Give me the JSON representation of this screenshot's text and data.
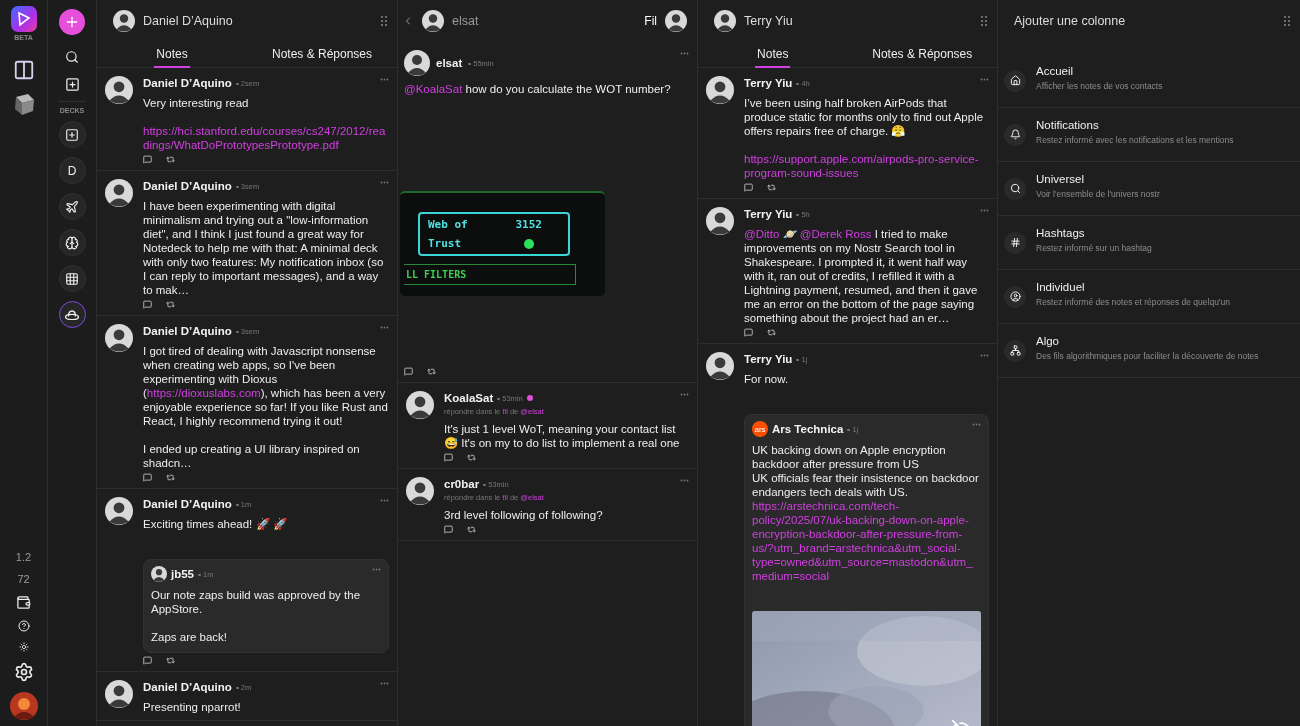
{
  "app_rail": {
    "badge": "BETA",
    "version": "1.2",
    "count": "72"
  },
  "deck_bar": {
    "label": "DECKS",
    "decks": [
      {
        "kind": "add",
        "selected": false
      },
      {
        "kind": "letter",
        "text": "D",
        "selected": false
      },
      {
        "kind": "plane",
        "selected": false
      },
      {
        "kind": "brain",
        "selected": false
      },
      {
        "kind": "grid",
        "selected": false
      },
      {
        "kind": "hat",
        "selected": true
      }
    ]
  },
  "columns": [
    {
      "kind": "profile",
      "title": "Daniel D’Aquino",
      "tabs": [
        {
          "label": "Notes",
          "selected": true
        },
        {
          "label": "Notes & Réponses",
          "selected": false
        }
      ],
      "notes": [
        {
          "author": "Daniel D’Aquino",
          "time": "2sem",
          "body": [
            {
              "kind": "text",
              "segments": [
                {
                  "kind": "text",
                  "text": "Very interesting read"
                }
              ]
            },
            {
              "kind": "blank"
            },
            {
              "kind": "link",
              "text": "https://hci.stanford.edu/courses/cs247/2012/readings/WhatDoPrototypesPrototype.pdf"
            }
          ]
        },
        {
          "author": "Daniel D’Aquino",
          "time": "3sem",
          "body": [
            {
              "kind": "text",
              "segments": [
                {
                  "kind": "text",
                  "text": "I have been experimenting with digital minimalism and trying out a \"low-information diet\", and I think I just found a great way for Notedeck to help me with that: A minimal deck with only two features: My notification inbox (so I can reply to important messages), and a way to mak…"
                }
              ]
            }
          ]
        },
        {
          "author": "Daniel D’Aquino",
          "time": "3sem",
          "body": [
            {
              "kind": "text",
              "segments": [
                {
                  "kind": "text",
                  "text": "I got tired of dealing with Javascript nonsense when creating web apps, so I've been experimenting with Dioxus ("
                },
                {
                  "kind": "link",
                  "text": "https://dioxuslabs.com"
                },
                {
                  "kind": "text",
                  "text": "), which has been a very enjoyable experience so far! If you like Rust and React, I highly recommend trying it out!"
                }
              ]
            },
            {
              "kind": "blank"
            },
            {
              "kind": "text",
              "segments": [
                {
                  "kind": "text",
                  "text": "I ended up creating a UI library inspired on shadcn…"
                }
              ]
            }
          ]
        },
        {
          "author": "Daniel D’Aquino",
          "time": "1m",
          "body": [
            {
              "kind": "text",
              "segments": [
                {
                  "kind": "text",
                  "text": "Exciting times ahead! 🚀 🚀"
                }
              ]
            }
          ],
          "quote": {
            "author": "jb55",
            "time": "1m",
            "avatar": {
              "kind": "person"
            },
            "body": [
              {
                "kind": "text",
                "segments": [
                  {
                    "kind": "text",
                    "text": "Our note zaps build was approved by the AppStore."
                  }
                ]
              },
              {
                "kind": "blank"
              },
              {
                "kind": "text",
                "segments": [
                  {
                    "kind": "text",
                    "text": "Zaps are back!"
                  }
                ]
              }
            ]
          }
        },
        {
          "author": "Daniel D’Aquino",
          "time": "2m",
          "body": [
            {
              "kind": "text",
              "segments": [
                {
                  "kind": "text",
                  "text": "Presenting nparrot!"
                }
              ]
            }
          ]
        }
      ]
    },
    {
      "kind": "thread",
      "title": "elsat",
      "label": "Fil",
      "root": {
        "author": "elsat",
        "time": "55min",
        "body": [
          {
            "kind": "text",
            "segments": [
              {
                "kind": "mention",
                "text": "@KoalaSat"
              },
              {
                "kind": "text",
                "text": " how do you calculate the WOT number?"
              }
            ]
          }
        ],
        "media": {
          "kind": "screenshot",
          "title_lines": [
            "Web of",
            "Trust"
          ],
          "value": "3152",
          "footer": "LL FILTERS"
        }
      },
      "replies": [
        {
          "author": "KoalaSat",
          "time": "53min",
          "online": true,
          "context": {
            "prefix": "répondre dans le",
            "thread": "fil",
            "middle": "de",
            "mention": "@elsat"
          },
          "body": [
            {
              "kind": "text",
              "segments": [
                {
                  "kind": "text",
                  "text": "It's just 1 level WoT, meaning your contact list 😅 It's on my to do list to implement a real one"
                }
              ]
            }
          ]
        },
        {
          "author": "cr0bar",
          "time": "53min",
          "online": false,
          "context": {
            "prefix": "répondre dans le",
            "thread": "fil",
            "middle": "de",
            "mention": "@elsat"
          },
          "body": [
            {
              "kind": "text",
              "segments": [
                {
                  "kind": "text",
                  "text": "3rd level following of following?"
                }
              ]
            }
          ]
        }
      ]
    },
    {
      "kind": "profile",
      "title": "Terry Yiu",
      "tabs": [
        {
          "label": "Notes",
          "selected": true
        },
        {
          "label": "Notes & Réponses",
          "selected": false
        }
      ],
      "notes": [
        {
          "author": "Terry Yiu",
          "time": "4h",
          "body": [
            {
              "kind": "text",
              "segments": [
                {
                  "kind": "text",
                  "text": "I’ve been using half broken AirPods that produce static for months only to find out Apple offers repairs free of charge. 😤"
                }
              ]
            },
            {
              "kind": "blank"
            },
            {
              "kind": "link",
              "text": "https://support.apple.com/airpods-pro-service-program-sound-issues"
            }
          ]
        },
        {
          "author": "Terry Yiu",
          "time": "5h",
          "body": [
            {
              "kind": "text",
              "segments": [
                {
                  "kind": "mention",
                  "text": "@Ditto"
                },
                {
                  "kind": "text",
                  "text": " 🪐 "
                },
                {
                  "kind": "mention",
                  "text": "@Derek Ross"
                },
                {
                  "kind": "text",
                  "text": " I tried to make improvements on my Nostr Search tool in Shakespeare. I prompted it, it went half way with it, ran out of credits, I refilled it with a Lightning payment, resumed, and then it gave me an error on the bottom of the page saying something about the project had an er…"
                }
              ]
            }
          ]
        },
        {
          "author": "Terry Yiu",
          "time": "1j",
          "body": [
            {
              "kind": "text",
              "segments": [
                {
                  "kind": "text",
                  "text": "For now."
                }
              ]
            }
          ],
          "quote": {
            "author": "Ars Technica",
            "time": "1j",
            "avatar": {
              "kind": "logo",
              "text": "ars"
            },
            "body": [
              {
                "kind": "text",
                "segments": [
                  {
                    "kind": "text",
                    "text": "UK backing down on Apple encryption backdoor after pressure from US"
                  }
                ]
              },
              {
                "kind": "text",
                "segments": [
                  {
                    "kind": "text",
                    "text": "UK officials fear their insistence on backdoor endangers tech deals with US."
                  }
                ]
              },
              {
                "kind": "link",
                "text": "https://arstechnica.com/tech-policy/2025/07/uk-backing-down-on-apple-encryption-backdoor-after-pressure-from-us/?utm_brand=arstechnica&utm_social-type=owned&utm_source=mastodon&utm_medium=social"
              }
            ],
            "media": {
              "kind": "picture",
              "blurred": true
            }
          }
        }
      ]
    },
    {
      "kind": "add",
      "title": "Ajouter une colonne",
      "options": [
        {
          "title": "Accueil",
          "description": "Afficher les notes de vos contacts"
        },
        {
          "title": "Notifications",
          "description": "Restez informé avec les notifications et les mentions"
        },
        {
          "title": "Universel",
          "description": "Voir l'ensemble de l'univers nostr"
        },
        {
          "title": "Hashtags",
          "description": "Restez informé sur un hashtag"
        },
        {
          "title": "Individuel",
          "description": "Restez informé des notes et réponses de quelqu'un"
        },
        {
          "title": "Algo",
          "description": "Des fils algorithmiques pour faciliter la découverte de notes"
        }
      ]
    }
  ]
}
